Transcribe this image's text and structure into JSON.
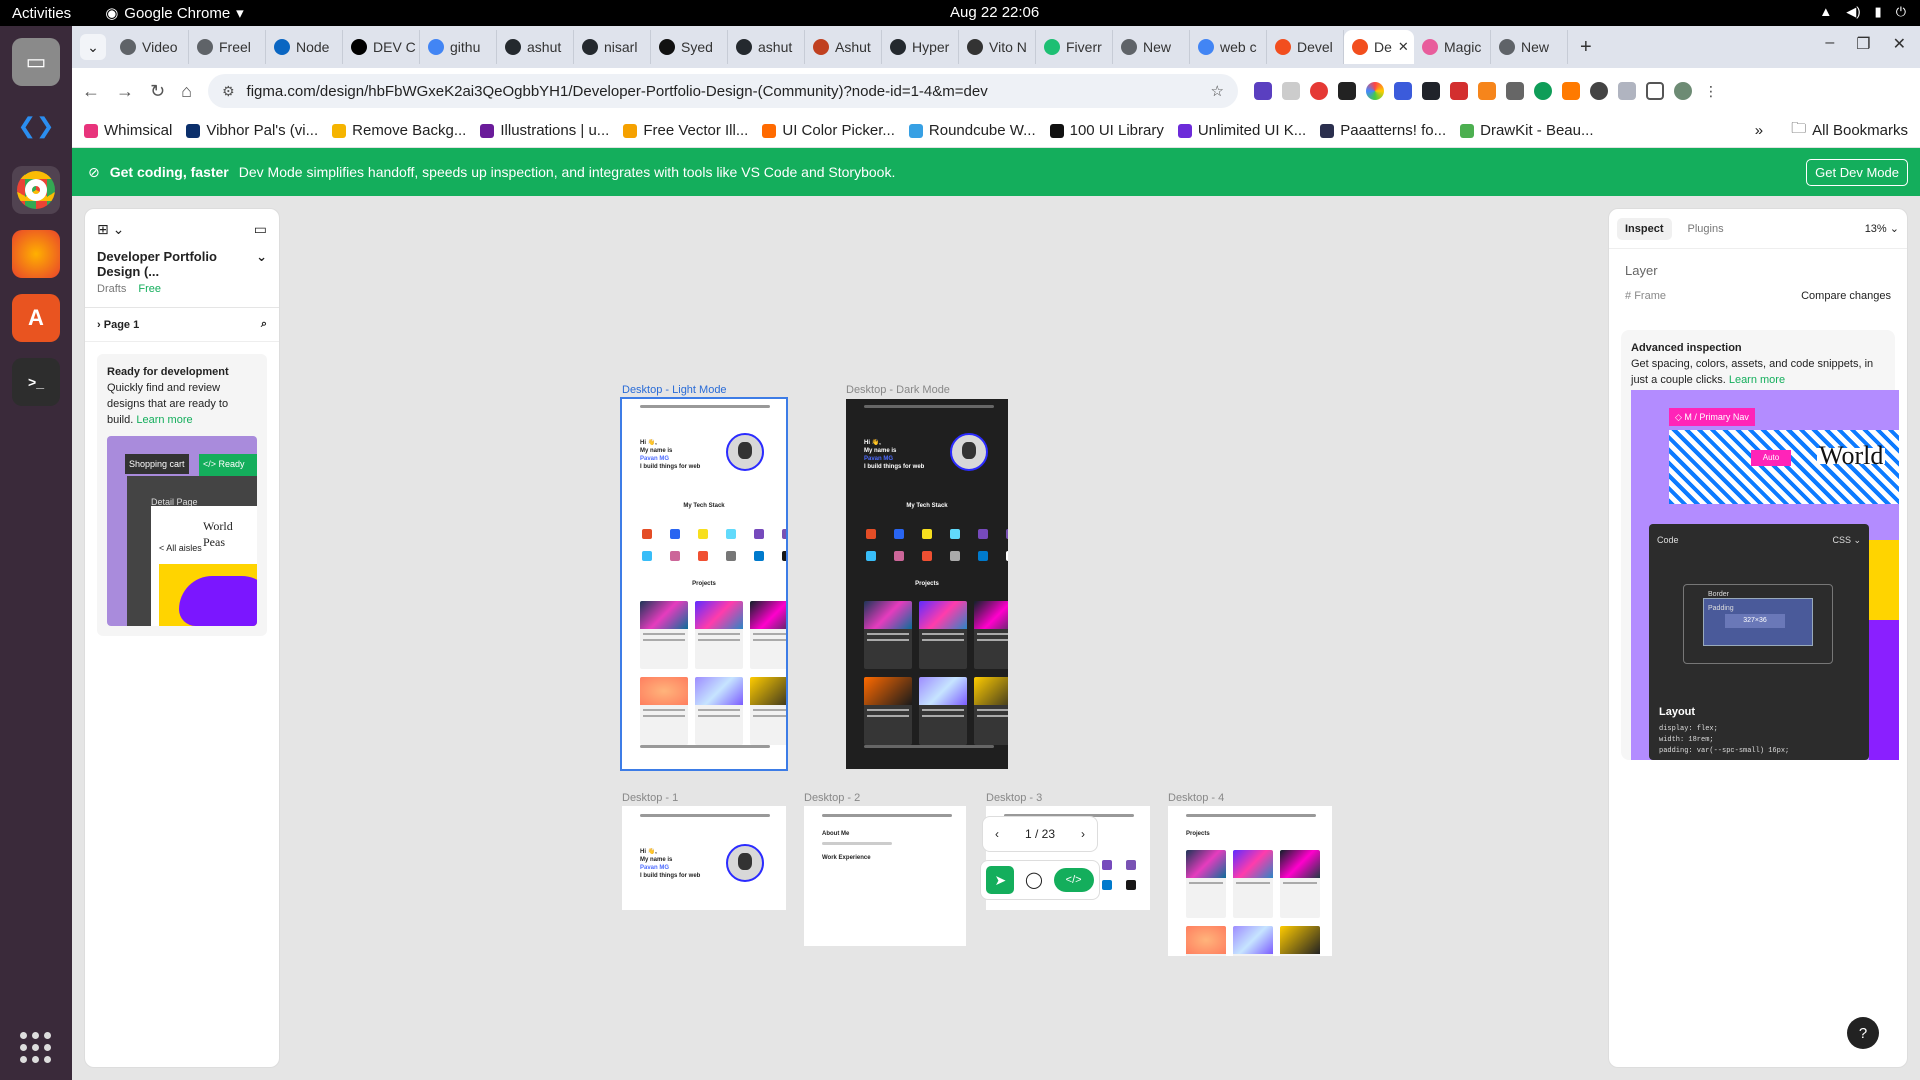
{
  "topbar": {
    "activities": "Activities",
    "app": "Google Chrome",
    "clock": "Aug 22  22:06"
  },
  "tabs": [
    {
      "label": "Video",
      "color": "#5f6368"
    },
    {
      "label": "Freel",
      "color": "#5f6368"
    },
    {
      "label": "Node",
      "color": "#0a66c2"
    },
    {
      "label": "DEV C",
      "color": "#000000"
    },
    {
      "label": "githu",
      "color": "#4285f4"
    },
    {
      "label": "ashut",
      "color": "#24292e"
    },
    {
      "label": "nisarl",
      "color": "#24292e"
    },
    {
      "label": "Syed",
      "color": "#111111"
    },
    {
      "label": "ashut",
      "color": "#24292e"
    },
    {
      "label": "Ashut",
      "color": "#c04020"
    },
    {
      "label": "Hyper",
      "color": "#24292e"
    },
    {
      "label": "Vito N",
      "color": "#333333"
    },
    {
      "label": "Fiverr",
      "color": "#1dbf73"
    },
    {
      "label": "New",
      "color": "#5f6368"
    },
    {
      "label": "web c",
      "color": "#4285f4"
    },
    {
      "label": "Devel",
      "color": "#f24e1e"
    },
    {
      "label": "De",
      "color": "#f24e1e",
      "active": true
    },
    {
      "label": "Magic",
      "color": "#e85d9c"
    },
    {
      "label": "New",
      "color": "#5f6368"
    }
  ],
  "url": "figma.com/design/hbFbWGxeK2ai3QeOgbbYH1/Developer-Portfolio-Design-(Community)?node-id=1-4&m=dev",
  "bookmarks": [
    {
      "label": "Whimsical",
      "color": "#e8347c"
    },
    {
      "label": "Vibhor Pal's (vi...",
      "color": "#0b2f6b"
    },
    {
      "label": "Remove Backg...",
      "color": "#f5b400"
    },
    {
      "label": "Illustrations | u...",
      "color": "#6a1b9a"
    },
    {
      "label": "Free Vector Ill...",
      "color": "#f5a100"
    },
    {
      "label": "UI Color Picker...",
      "color": "#ff6a00"
    },
    {
      "label": "Roundcube W...",
      "color": "#37a0e4"
    },
    {
      "label": "100 UI Library",
      "color": "#111111"
    },
    {
      "label": "Unlimited UI K...",
      "color": "#6c2bd9"
    },
    {
      "label": "Paaatterns! fo...",
      "color": "#2b2f4e"
    },
    {
      "label": "DrawKit - Beau...",
      "color": "#4caf50"
    }
  ],
  "bookmarks_more": "»",
  "all_bookmarks": "All Bookmarks",
  "banner": {
    "title": "Get coding, faster",
    "text": "Dev Mode simplifies handoff, speeds up inspection, and integrates with tools like VS Code and Storybook.",
    "button": "Get Dev Mode"
  },
  "left": {
    "file": "Developer Portfolio Design (...",
    "drafts": "Drafts",
    "plan": "Free",
    "page": "Page 1",
    "ready_title": "Ready for development",
    "ready_text": "Quickly find and review designs that are ready to build.",
    "learn": "Learn more",
    "img_cart": "Shopping cart",
    "img_ready": "</> Ready for dev",
    "img_detail": "Detail Page",
    "img_world": "World Peas",
    "img_aisles": "< All aisles"
  },
  "frames": {
    "light": "Desktop - Light Mode",
    "dark": "Desktop - Dark Mode",
    "d1": "Desktop - 1",
    "d2": "Desktop - 2",
    "d3": "Desktop - 3",
    "d4": "Desktop - 4"
  },
  "hero": {
    "hi": "Hi 👋,",
    "name1": "My name is",
    "name2": "Pavan MG",
    "tag": "I build things for web"
  },
  "sections": {
    "stack": "My Tech Stack",
    "projects": "Projects",
    "about": "About Me",
    "work": "Work Experience"
  },
  "pager": {
    "text": "1 / 23",
    "prev": "‹",
    "next": "›"
  },
  "right": {
    "tab_inspect": "Inspect",
    "tab_plugins": "Plugins",
    "zoom": "13%",
    "layer": "Layer",
    "frame": "Frame",
    "compare": "Compare changes",
    "adv_title": "Advanced inspection",
    "adv_text": "Get spacing, colors, assets, and code snippets, in just a couple clicks.",
    "learn": "Learn more",
    "nav": "◇ M / Primary Nav",
    "world": "World",
    "auto": "Auto",
    "code": "Code",
    "css": "CSS ⌄",
    "border": "Border",
    "padding": "Padding",
    "size": "327×36",
    "layout": "Layout",
    "css1": "display: flex;",
    "css2": "width: 18rem;",
    "css3": "padding: var(--spc-small) 16px;"
  },
  "help": "?"
}
